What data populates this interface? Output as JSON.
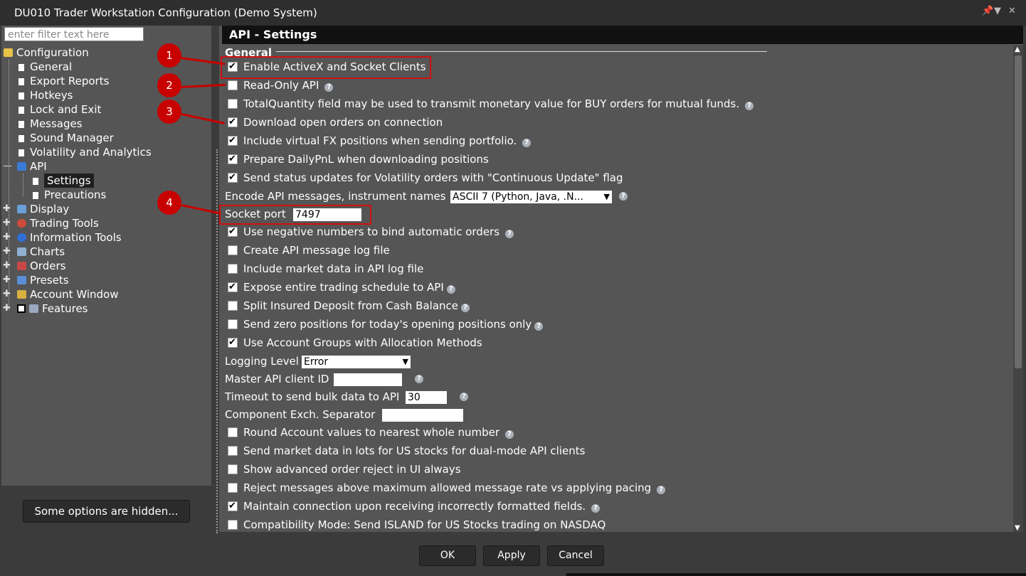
{
  "window": {
    "title": "DU010 Trader Workstation Configuration (Demo System)"
  },
  "filter": {
    "placeholder": "enter filter text here"
  },
  "tree": {
    "root": "Configuration",
    "items": [
      "General",
      "Export Reports",
      "Hotkeys",
      "Lock and Exit",
      "Messages",
      "Sound Manager",
      "Volatility and Analytics"
    ],
    "api": "API",
    "api_children": [
      "Settings",
      "Precautions"
    ],
    "groups": [
      "Display",
      "Trading Tools",
      "Information Tools",
      "Charts",
      "Orders",
      "Presets",
      "Account Window",
      "Features"
    ]
  },
  "hidden_options_label": "Some options are hidden...",
  "panel": {
    "title": "API - Settings",
    "section": "General"
  },
  "options": {
    "enable_activex": {
      "label": "Enable ActiveX and Socket Clients",
      "checked": true
    },
    "read_only": {
      "label": "Read-Only API",
      "checked": false
    },
    "total_quantity": {
      "label": "TotalQuantity field may be used to transmit monetary value for BUY orders for mutual funds.",
      "checked": false
    },
    "download_open_orders": {
      "label": "Download open orders on connection",
      "checked": true
    },
    "virtual_fx": {
      "label": "Include virtual FX positions when sending portfolio.",
      "checked": true
    },
    "daily_pnl": {
      "label": "Prepare DailyPnL when downloading positions",
      "checked": true
    },
    "status_updates": {
      "label": "Send status updates for Volatility orders with \"Continuous Update\" flag",
      "checked": true
    },
    "negative_numbers": {
      "label": "Use negative numbers to bind automatic orders",
      "checked": true
    },
    "create_log": {
      "label": "Create API message log file",
      "checked": false
    },
    "market_data_log": {
      "label": "Include market data in API log file",
      "checked": false
    },
    "trading_schedule": {
      "label": "Expose entire trading schedule to API",
      "checked": true
    },
    "split_insured": {
      "label": "Split Insured Deposit from Cash Balance",
      "checked": false
    },
    "zero_positions": {
      "label": "Send zero positions for today's opening positions only",
      "checked": false
    },
    "account_groups": {
      "label": "Use Account Groups with Allocation Methods",
      "checked": true
    },
    "round_account": {
      "label": "Round Account values to nearest whole number",
      "checked": false
    },
    "market_data_lots": {
      "label": "Send market data in lots for US stocks for dual-mode API clients",
      "checked": false
    },
    "advanced_reject": {
      "label": "Show advanced order reject in UI always",
      "checked": false
    },
    "reject_messages": {
      "label": "Reject messages above maximum allowed message rate vs applying pacing",
      "checked": false
    },
    "maintain_connection": {
      "label": "Maintain connection upon receiving incorrectly formatted fields.",
      "checked": true
    },
    "compatibility": {
      "label": "Compatibility Mode: Send ISLAND for US Stocks trading on NASDAQ",
      "checked": false
    }
  },
  "encode": {
    "label": "Encode API messages, instrument names",
    "value": "ASCII 7 (Python, Java, .N..."
  },
  "socket_port": {
    "label": "Socket port",
    "value": "7497"
  },
  "logging": {
    "label": "Logging Level",
    "value": "Error"
  },
  "master_client": {
    "label": "Master API client ID",
    "value": ""
  },
  "timeout": {
    "label": "Timeout to send bulk data to API",
    "value": "30"
  },
  "separator": {
    "label": "Component Exch. Separator",
    "value": ""
  },
  "markers": [
    "1",
    "2",
    "3",
    "4"
  ],
  "buttons": {
    "ok": "OK",
    "apply": "Apply",
    "cancel": "Cancel"
  },
  "colors": {
    "marker": "#c80000",
    "background": "#555555",
    "header": "#111111"
  }
}
